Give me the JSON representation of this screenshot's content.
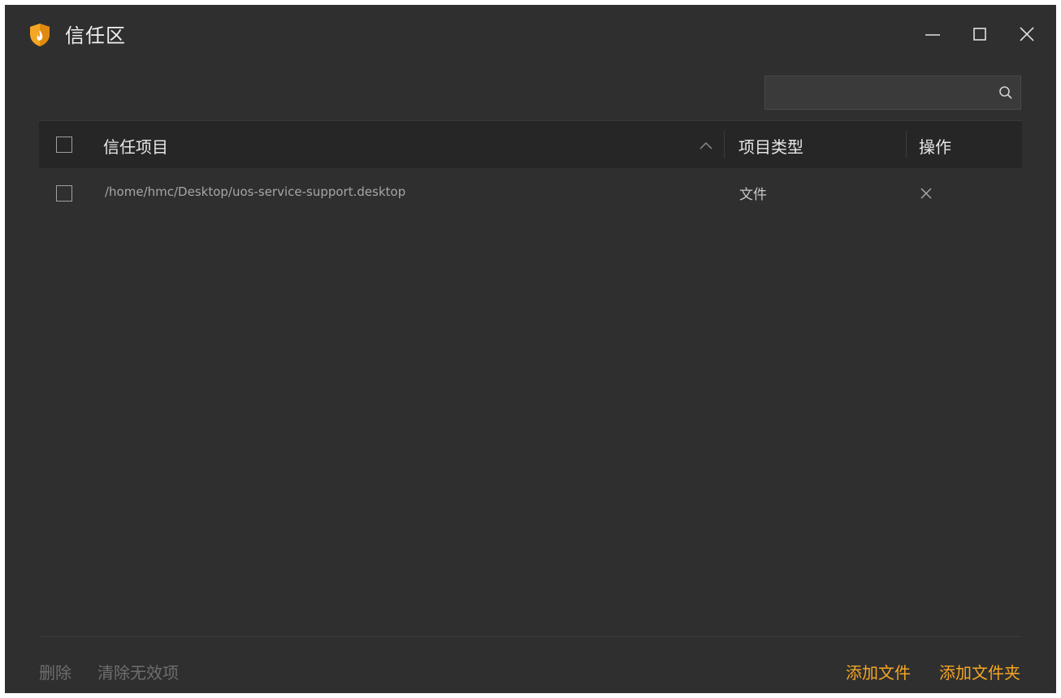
{
  "window": {
    "title": "信任区",
    "app_icon": "shield-flame-icon",
    "controls": [
      "minimize-icon",
      "maximize-icon",
      "close-icon"
    ]
  },
  "search": {
    "value": "",
    "placeholder": "",
    "icon": "search-icon"
  },
  "table": {
    "columns": [
      {
        "label": "信任项目",
        "sort": "ascending"
      },
      {
        "label": "项目类型"
      },
      {
        "label": "操作"
      }
    ],
    "rows": [
      {
        "checked": false,
        "path": "/home/hmc/Desktop/uos-service-support.desktop",
        "type": "文件",
        "action_icon": "remove-x-icon"
      }
    ]
  },
  "footer": {
    "delete_label": "删除",
    "clear_invalid_label": "清除无效项",
    "add_file_label": "添加文件",
    "add_folder_label": "添加文件夹"
  },
  "colors": {
    "background": "#2f2f2f",
    "header_bg": "#262626",
    "accent": "#f5a623",
    "disabled_text": "#6e6e6e"
  }
}
